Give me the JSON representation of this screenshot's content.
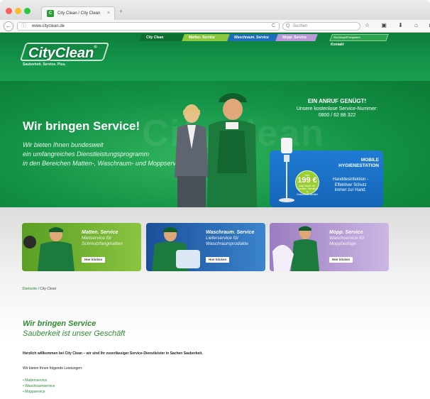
{
  "browser": {
    "tab_title": "City Clean / City Clean",
    "tab_close": "×",
    "new_tab": "+",
    "back": "←",
    "info": "ⓘ",
    "url": "www.cityclean.de",
    "reload": "C",
    "search_placeholder": "Suchen",
    "search_icon": "Q",
    "toolbar_icons": [
      "star-icon",
      "clipboard-icon",
      "download-icon",
      "home-icon",
      "pocket-icon",
      "menu-icon"
    ],
    "toolbar_glyphs": "☆ ▣ ⬇ ⌂ ◙ ≡"
  },
  "site": {
    "logo": "CityClean",
    "logo_reg": "®",
    "logo_tagline": "Sauberkeit. Service. Plus.",
    "nav": [
      "City Clean",
      "Matten. Service",
      "Waschraum. Service",
      "Mopp. Service"
    ],
    "site_search_placeholder": "Suchbegriff eingeben",
    "kontakt": "Kontakt"
  },
  "hero": {
    "headline": "Wir bringen Service!",
    "sub_line1": "Wir bieten Ihnen bundesweit",
    "sub_line2": "ein umfangreiches Dienstleistungsprogramm",
    "sub_line3": "in den Bereichen Matten-, Waschraum- und Moppservice.",
    "call_title": "EIN ANRUF GENÜGT!",
    "call_sub": "Unsere kostenlose Service-Nummer:",
    "call_number": "0800 / 62 88 322",
    "promo_title_1": "MOBILE",
    "promo_title_2": "HYGIENESTATION",
    "promo_desc_1": "Handdesinfektion -",
    "promo_desc_2": "Effektiver Schutz",
    "promo_desc_3": "immer zur Hand.",
    "price_top": "Nur",
    "price": "199 €",
    "price_note": "zzgl. MwSt. für Spender, Standfuß & Desinfektionsmittel",
    "bg_word": "CityClean"
  },
  "cards": [
    {
      "title": "Matten. Service",
      "line1": "Mietservice für",
      "line2": "Schmutzfangmatten",
      "button": "Hier klicken"
    },
    {
      "title": "Waschraum. Service",
      "line1": "Lieferservice für",
      "line2": "Waschraumprodukte",
      "button": "Hier klicken"
    },
    {
      "title": "Mopp. Service",
      "line1": "Waschservice für",
      "line2": "Moppbezüge",
      "button": "Hier klicken"
    }
  ],
  "content": {
    "breadcrumb_home": "Startseite",
    "breadcrumb_sep": " / ",
    "breadcrumb_current": "City Clean",
    "heading": "Wir bringen Service",
    "subheading": "Sauberkeit ist unser Geschäft",
    "intro": "Herzlich willkommen bei City Clean – wir sind Ihr zuverlässiger Service-Dienstleister in Sachen Sauberkeit.",
    "services_intro": "Wir bieten Ihnen folgende Leistungen:",
    "services": [
      "Mattenservice",
      "Waschraumservice",
      "Moppservice"
    ]
  },
  "colors": {
    "brand_green": "#14944a",
    "matten_green": "#8dc63f",
    "waschraum_blue": "#1f6fb8",
    "mopp_purple": "#b79ad6",
    "link_green": "#2a8a3a"
  }
}
